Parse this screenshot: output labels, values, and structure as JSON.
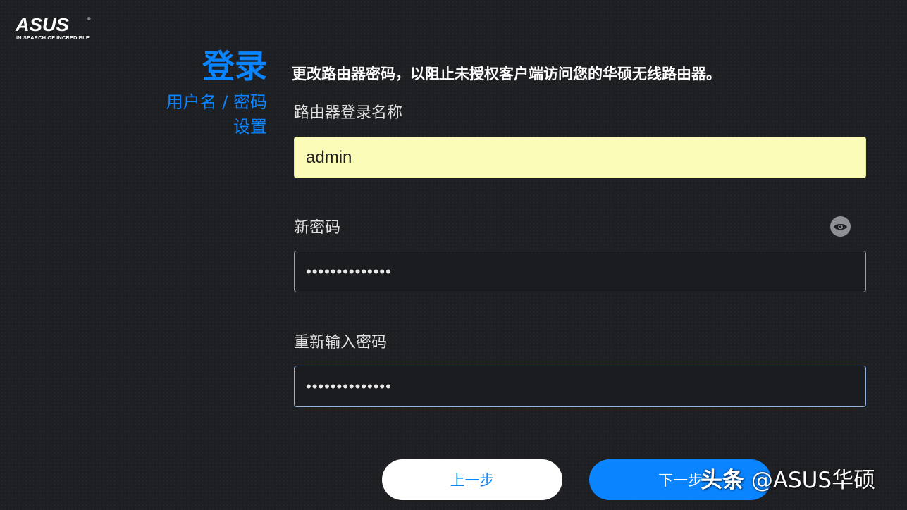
{
  "brand": {
    "logo_word": "ASUS",
    "logo_registered": "®",
    "tagline": "IN SEARCH OF INCREDIBLE"
  },
  "step": {
    "title": "登录",
    "subtitle_line1": "用户名 / 密码",
    "subtitle_line2": "设置"
  },
  "instruction": "更改路由器密码，以阻止未授权客户端访问您的华硕无线路由器。",
  "form": {
    "username": {
      "label": "路由器登录名称",
      "value": "admin"
    },
    "new_password": {
      "label": "新密码",
      "value": "••••••••••••••"
    },
    "confirm_password": {
      "label": "重新输入密码",
      "value": "••••••••••••••"
    },
    "show_password_icon": "eye-icon"
  },
  "buttons": {
    "prev": "上一步",
    "next": "下一步"
  },
  "watermark": {
    "prefix": "头条",
    "handle": " @ASUS华硕"
  },
  "colors": {
    "accent": "#0a84ff",
    "background": "#1e1f22",
    "username_field_bg": "#fbfcb8",
    "eye_icon_bg": "#8d8f93"
  }
}
